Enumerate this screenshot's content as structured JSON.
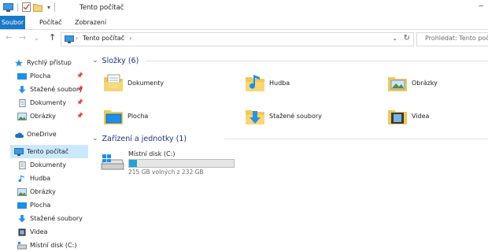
{
  "window": {
    "title": "Tento počítač"
  },
  "ribbon": {
    "tabs": [
      "Soubor",
      "Počítač",
      "Zobrazení"
    ]
  },
  "address": {
    "crumbs": [
      "Tento počítač"
    ],
    "search_placeholder": "Prohledat: Tento počítač"
  },
  "sidebar": {
    "items": [
      {
        "label": "Rychlý přístup",
        "icon": "star-icon"
      },
      {
        "label": "Plocha",
        "icon": "desktop-icon",
        "pinned": true
      },
      {
        "label": "Stažené soubory",
        "icon": "download-icon",
        "pinned": true
      },
      {
        "label": "Dokumenty",
        "icon": "document-icon",
        "pinned": true
      },
      {
        "label": "Obrázky",
        "icon": "pictures-icon",
        "pinned": true
      },
      {
        "label": "OneDrive",
        "icon": "cloud-icon"
      },
      {
        "label": "Tento počítač",
        "icon": "computer-icon",
        "selected": true
      },
      {
        "label": "Dokumenty",
        "icon": "document-icon"
      },
      {
        "label": "Hudba",
        "icon": "music-icon"
      },
      {
        "label": "Obrázky",
        "icon": "pictures-icon"
      },
      {
        "label": "Plocha",
        "icon": "desktop-icon"
      },
      {
        "label": "Stažené soubory",
        "icon": "download-icon"
      },
      {
        "label": "Videa",
        "icon": "video-icon"
      },
      {
        "label": "Místní disk (C:)",
        "icon": "drive-icon"
      }
    ]
  },
  "main": {
    "folders_header": "Složky (6)",
    "folders": [
      {
        "label": "Dokumenty",
        "icon": "documents-folder-icon"
      },
      {
        "label": "Hudba",
        "icon": "music-folder-icon"
      },
      {
        "label": "Obrázky",
        "icon": "pictures-folder-icon"
      },
      {
        "label": "Plocha",
        "icon": "desktop-folder-icon"
      },
      {
        "label": "Stažené soubory",
        "icon": "downloads-folder-icon"
      },
      {
        "label": "Videa",
        "icon": "videos-folder-icon"
      }
    ],
    "devices_header": "Zařízení a jednotky (1)",
    "drive": {
      "name": "Místní disk (C:)",
      "space_text": "215 GB volných z 232 GB",
      "used_fraction": 0.073
    }
  },
  "colors": {
    "accent": "#1979ca",
    "selected_bg": "#cce8ff",
    "header_text": "#1e3287",
    "drive_bar": "#26a0da"
  }
}
